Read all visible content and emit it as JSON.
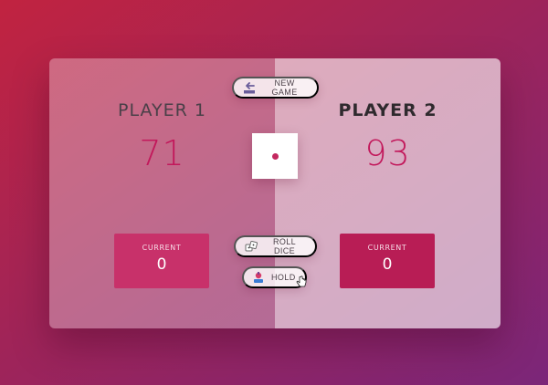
{
  "players": [
    {
      "name": "PLAYER 1",
      "score": "71",
      "current_label": "CURRENT",
      "current_score": "0",
      "active": false
    },
    {
      "name": "PLAYER 2",
      "score": "93",
      "current_label": "CURRENT",
      "current_score": "0",
      "active": true
    }
  ],
  "buttons": {
    "new_game": "NEW GAME",
    "roll_dice": "ROLL DICE",
    "hold": "HOLD"
  },
  "dice": {
    "value": 1
  },
  "icons": {
    "new_game": "end-arrow-icon",
    "roll_dice": "dice-icon",
    "hold": "bank-icon",
    "cursor": "hand-pointer-icon"
  },
  "colors": {
    "accent": "#c2185b",
    "current_box": "#c3285f"
  }
}
